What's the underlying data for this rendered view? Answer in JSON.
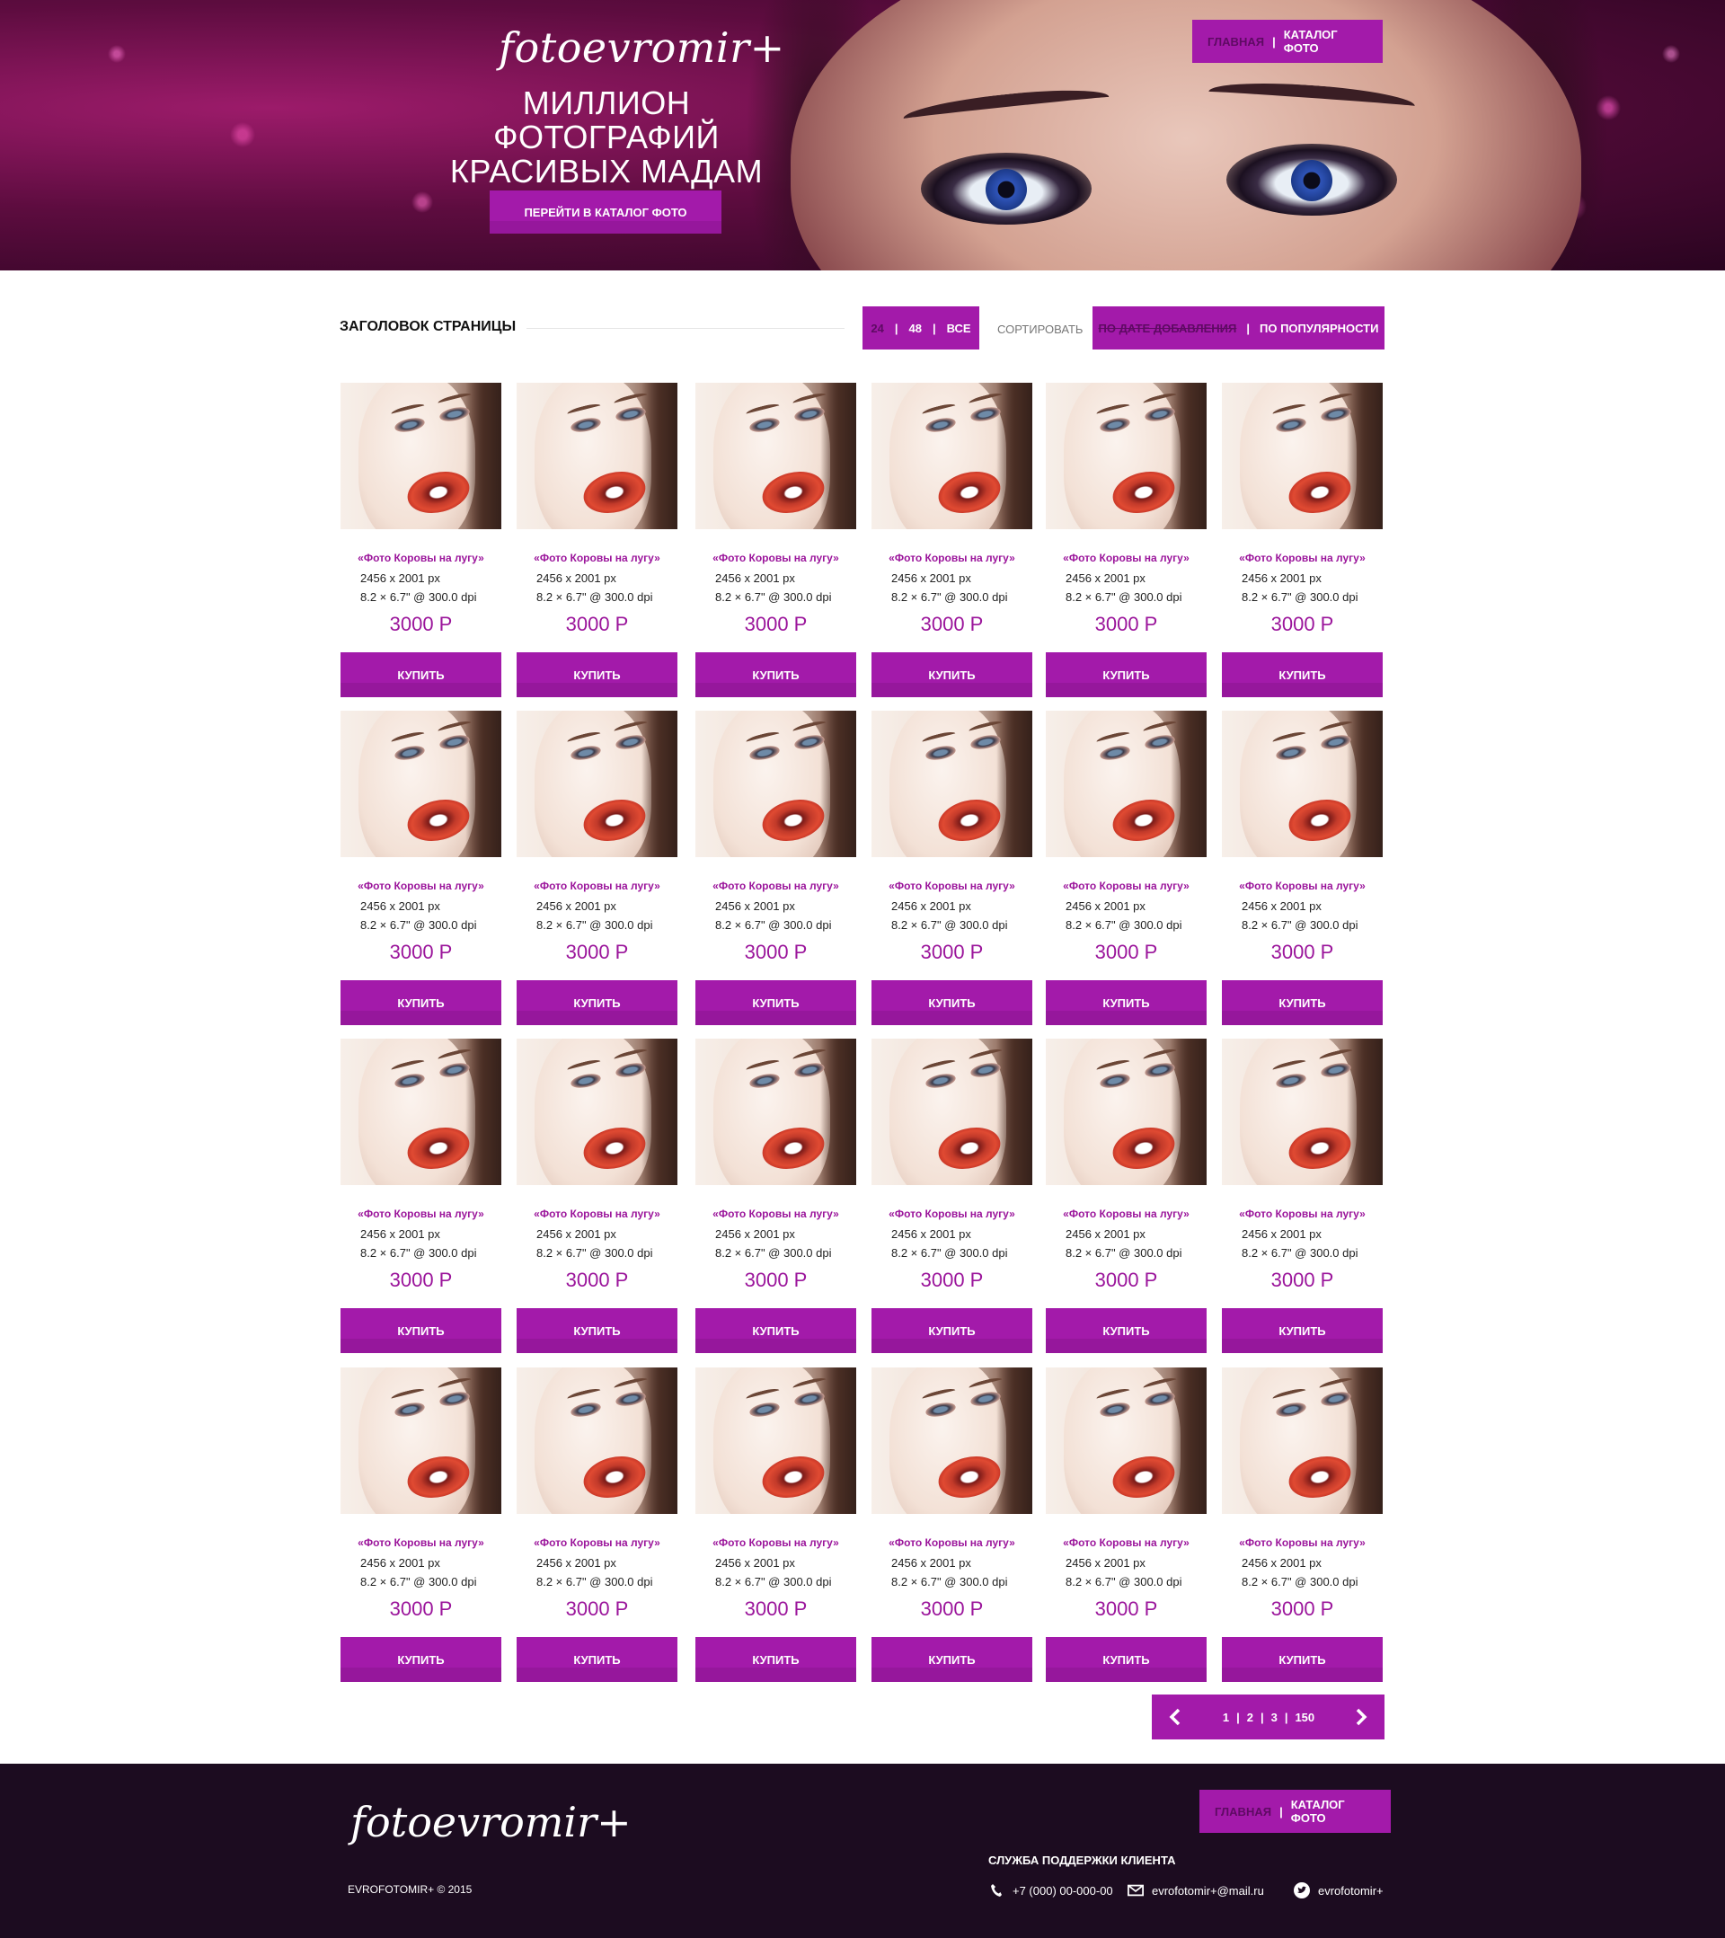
{
  "site": {
    "logo": "fotoevromir+",
    "hero_line1": "МИЛЛИОН ФОТОГРАФИЙ",
    "hero_line2": "КРАСИВЫХ МАДАМ",
    "hero_cta": "ПЕРЕЙТИ В КАТАЛОГ ФОТО"
  },
  "nav": {
    "home": "ГЛАВНАЯ",
    "separator": "|",
    "catalog": "КАТАЛОГ ФОТО",
    "active": "home"
  },
  "controls": {
    "page_title": "ЗАГОЛОВОК СТРАНИЦЫ",
    "per_page": [
      "24",
      "48",
      "ВСЕ"
    ],
    "per_page_active": "24",
    "separator": "|",
    "sort_label": "СОРТИРОВАТЬ",
    "sort_options": [
      "ПО ДАТЕ ДОБАВЛЕНИЯ",
      "ПО ПОПУЛЯРНОСТИ"
    ],
    "sort_active": "ПО ДАТЕ ДОБАВЛЕНИЯ"
  },
  "product": {
    "name": "«Фото Коровы на лугу»",
    "dims": "2456 x 2001 px",
    "dpi": "8.2 × 6.7\" @ 300.0 dpi",
    "price": "3000 Р",
    "buy": "КУПИТЬ",
    "count": 24,
    "columns": 6
  },
  "pagination": {
    "pages": [
      "1",
      "2",
      "3",
      "150"
    ],
    "separator": "|",
    "prev_icon": "chevron-left-icon",
    "next_icon": "chevron-right-icon"
  },
  "footer": {
    "logo": "fotoevromir+",
    "copyright": "EVROFOTOMIR+ © 2015",
    "support_title": "СЛУЖБА ПОДДЕРЖКИ КЛИЕНТА",
    "phone": "+7 (000) 00-000-00",
    "email": "evrofotomir+@mail.ru",
    "twitter": "evrofotomir+"
  },
  "colors": {
    "accent": "#a31aaa",
    "accent_active": "#5e0a63",
    "price": "#9b159b",
    "footer_bg": "#1c0c20"
  }
}
